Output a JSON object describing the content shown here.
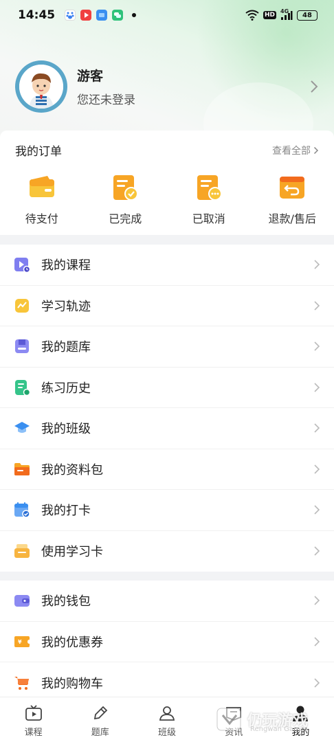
{
  "status_bar": {
    "time": "14:45",
    "hd": "HD",
    "network": "4G",
    "battery": "48"
  },
  "profile": {
    "name": "游客",
    "subtitle": "您还未登录"
  },
  "orders": {
    "title": "我的订单",
    "view_all": "查看全部",
    "items": [
      {
        "label": "待支付",
        "icon": "wallet-icon"
      },
      {
        "label": "已完成",
        "icon": "completed-order-icon"
      },
      {
        "label": "已取消",
        "icon": "cancelled-order-icon"
      },
      {
        "label": "退款/售后",
        "icon": "refund-icon"
      }
    ]
  },
  "menu_group1": [
    {
      "label": "我的课程",
      "icon": "course-video-icon"
    },
    {
      "label": "学习轨迹",
      "icon": "learning-track-icon"
    },
    {
      "label": "我的题库",
      "icon": "question-bank-icon"
    },
    {
      "label": "练习历史",
      "icon": "practice-history-icon"
    },
    {
      "label": "我的班级",
      "icon": "graduation-cap-icon"
    },
    {
      "label": "我的资料包",
      "icon": "folder-icon"
    },
    {
      "label": "我的打卡",
      "icon": "calendar-check-icon"
    },
    {
      "label": "使用学习卡",
      "icon": "study-card-icon"
    }
  ],
  "menu_group2": [
    {
      "label": "我的钱包",
      "icon": "wallet-purple-icon"
    },
    {
      "label": "我的优惠券",
      "icon": "coupon-icon"
    },
    {
      "label": "我的购物车",
      "icon": "cart-icon"
    }
  ],
  "bottom_nav": [
    {
      "label": "课程",
      "icon": "tv-play-icon"
    },
    {
      "label": "题库",
      "icon": "pencil-icon"
    },
    {
      "label": "班级",
      "icon": "users-icon"
    },
    {
      "label": "资讯",
      "icon": "news-icon"
    },
    {
      "label": "我的",
      "icon": "person-icon"
    }
  ],
  "watermark": {
    "text": "仍玩游戏",
    "sub": "Rengwan Games"
  },
  "colors": {
    "orange": "#f7a525",
    "green": "#35c48a",
    "purple": "#7f7ef0",
    "blue": "#3a8ff0",
    "yellow": "#f8c53a"
  }
}
